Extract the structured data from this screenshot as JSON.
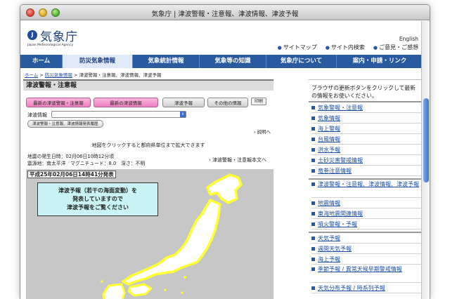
{
  "window": {
    "title": "気象庁 | 津波警報・注意報、津波情報、津波予報"
  },
  "header": {
    "logo_mark": "J",
    "logo_text": "気象庁",
    "logo_en": "Japan Meteorological Agency",
    "english_link": "English",
    "links": [
      "サイトマップ",
      "サイト内検索",
      "ご意見・ご感想"
    ]
  },
  "mainnav": [
    "ホーム",
    "防災気象情報",
    "気象統計情報",
    "気象等の知識",
    "気象庁について",
    "案内・申請・リンク"
  ],
  "breadcrumb": {
    "home": "ホーム",
    "sep": " > ",
    "parent": "防災気象情報",
    "current": "津波警報・注意報、津波情報、津波予報"
  },
  "main": {
    "section_title": "津波警報・注意報",
    "buttons": [
      "最新の津波警報・注意報",
      "最新の津波情報",
      "津波予報",
      "その他の情報"
    ],
    "print_label": "印刷",
    "tsunami_info_label": "津波情報",
    "history_button": "津波警報・注意報、津波情報発表履歴",
    "explain_link": "説明へ",
    "click_map_text": "地図をクリックすると都府県単位まで拡大できます",
    "eq_time": "地震の発生日時：02月06日10時12分頃",
    "eq_source": "震源地：南太平洋　マグニチュード：8.0　深さ：不明",
    "full_text_link": "津波警報・注意報本文へ"
  },
  "map": {
    "timestamp": "平成25年02月06日14時41分発表",
    "notice_lines": [
      "津波予報（若干の海面変動）を",
      "発表していますので",
      "津波予報をご覧ください"
    ],
    "coast_color": "#ffff33",
    "land_color": "#ffffff",
    "sea_color": "#c7c7c7"
  },
  "sidebar": {
    "intro": "ブラウザの更新ボタンをクリックして最新の情報をお使いください。",
    "group1": [
      "気象警報・注意報",
      "気象情報",
      "海上警報",
      "台風情報",
      "洪水予報",
      "土砂災害警戒情報",
      "竜巻注意情報"
    ],
    "group2": [
      "津波警報・注意報、津波情報、津波予報",
      "地震情報",
      "東海地震関連情報",
      "噴火警報・予報"
    ],
    "group3": [
      "天気予報",
      "週間天気予報",
      "海上予報",
      "季節予報 / 異常天候早期警戒情報",
      "天気分布予報 / 時系列予報"
    ]
  },
  "colors": {
    "accent": "#2a5aa0",
    "pink_button": "#ee80c3",
    "link": "#1b4fa0"
  }
}
